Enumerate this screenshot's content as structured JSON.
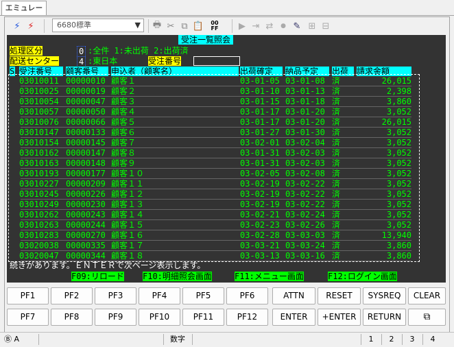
{
  "app": {
    "tab": "エミュレータ"
  },
  "toolbar": {
    "combo_value": "6680標準",
    "ff_label": "00\nFF"
  },
  "screen": {
    "title": "受注一覧照会",
    "lbl_process": "処理区分",
    "process_value": "0",
    "process_opts": ":全件 1:未出荷 2:出荷済",
    "lbl_center": "配送センター",
    "center_value": "4",
    "center_name": ":東日本",
    "lbl_order_no": "受注番号",
    "headers": [
      "S",
      "受注番号",
      "顧客番号",
      "申込者（顧客名）",
      "出荷確定",
      "納品予定",
      "出荷",
      "請求金額"
    ],
    "rows": [
      [
        "03010011",
        "00000010",
        "顧客１",
        "03-01-05",
        "03-01-08",
        "済",
        "26,015"
      ],
      [
        "03010025",
        "00000019",
        "顧客２",
        "03-01-10",
        "03-01-13",
        "済",
        "2,398"
      ],
      [
        "03010054",
        "00000047",
        "顧客３",
        "03-01-15",
        "03-01-18",
        "済",
        "3,860"
      ],
      [
        "03010057",
        "00000050",
        "顧客４",
        "03-01-17",
        "03-01-20",
        "済",
        "3,052"
      ],
      [
        "03010076",
        "00000066",
        "顧客５",
        "03-01-17",
        "03-01-20",
        "済",
        "26,015"
      ],
      [
        "03010147",
        "00000133",
        "顧客６",
        "03-01-27",
        "03-01-30",
        "済",
        "3,052"
      ],
      [
        "03010154",
        "00000145",
        "顧客７",
        "03-02-01",
        "03-02-04",
        "済",
        "3,052"
      ],
      [
        "03010162",
        "00000147",
        "顧客８",
        "03-01-31",
        "03-02-03",
        "済",
        "3,052"
      ],
      [
        "03010163",
        "00000148",
        "顧客９",
        "03-01-31",
        "03-02-03",
        "済",
        "3,052"
      ],
      [
        "03010193",
        "00000177",
        "顧客１０",
        "03-02-05",
        "03-02-08",
        "済",
        "3,052"
      ],
      [
        "03010227",
        "00000209",
        "顧客１１",
        "03-02-19",
        "03-02-22",
        "済",
        "3,052"
      ],
      [
        "03010245",
        "00000226",
        "顧客１２",
        "03-02-19",
        "03-02-22",
        "済",
        "3,052"
      ],
      [
        "03010249",
        "00000230",
        "顧客１３",
        "03-02-19",
        "03-02-22",
        "済",
        "3,052"
      ],
      [
        "03010262",
        "00000243",
        "顧客１４",
        "03-02-21",
        "03-02-24",
        "済",
        "3,052"
      ],
      [
        "03010263",
        "00000244",
        "顧客１５",
        "03-02-23",
        "03-02-26",
        "済",
        "3,052"
      ],
      [
        "03010283",
        "00000270",
        "顧客１６",
        "03-02-28",
        "03-03-03",
        "済",
        "13,940"
      ],
      [
        "03020038",
        "00000335",
        "顧客１７",
        "03-03-21",
        "03-03-24",
        "済",
        "3,860"
      ],
      [
        "03020047",
        "00000344",
        "顧客１８",
        "03-03-13",
        "03-03-16",
        "済",
        "3,860"
      ]
    ],
    "more_msg": "続きがあります。ＥＮＴＥＲで次ページ表示します。",
    "fkeys": [
      "F09:リロード",
      "F10:明細照会画面",
      "F11:メニュー画面",
      "F12:ログイン画面"
    ]
  },
  "pf_row1": [
    "PF1",
    "PF2",
    "PF3",
    "PF4",
    "PF5",
    "PF6",
    "ATTN",
    "RESET",
    "SYSREQ",
    "CLEAR"
  ],
  "pf_row2": [
    "PF7",
    "PF8",
    "PF9",
    "PF10",
    "PF11",
    "PF12",
    "ENTER",
    "+ENTER",
    "RETURN",
    ""
  ],
  "status": {
    "indicator": "Ⓑ A",
    "mode": "数字",
    "sessions": [
      "1",
      "2",
      "3",
      "4"
    ]
  }
}
